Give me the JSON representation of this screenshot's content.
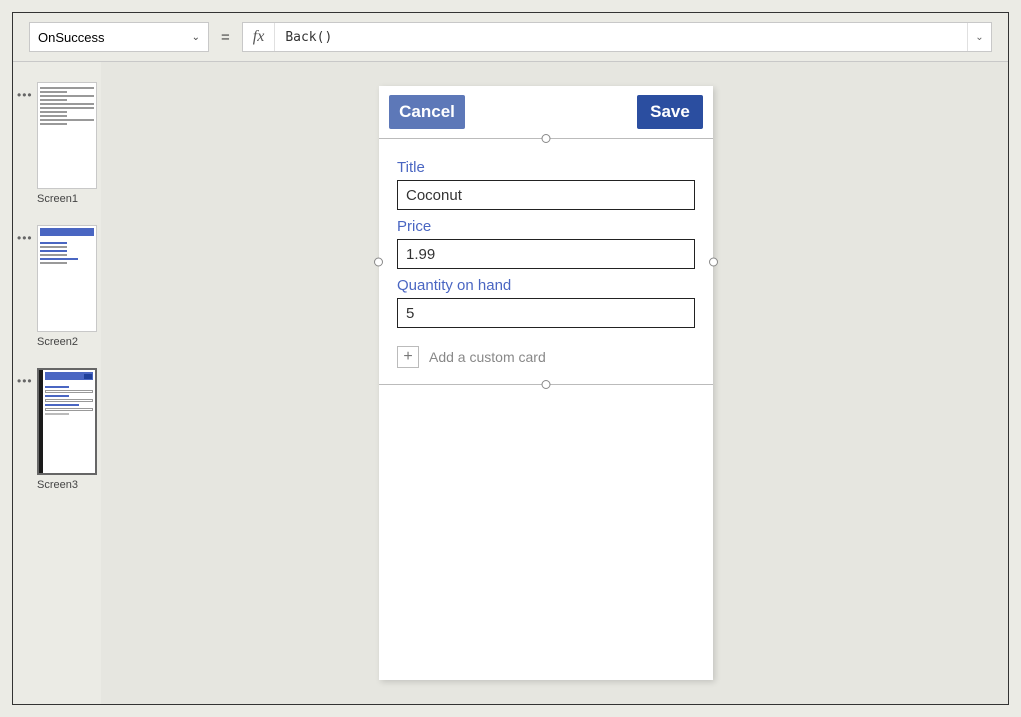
{
  "formulaBar": {
    "property": "OnSuccess",
    "equals": "=",
    "fxLabel": "fx",
    "formula": "Back()"
  },
  "screens": {
    "items": [
      {
        "label": "Screen1"
      },
      {
        "label": "Screen2"
      },
      {
        "label": "Screen3"
      }
    ]
  },
  "phone": {
    "cancelLabel": "Cancel",
    "saveLabel": "Save",
    "fields": [
      {
        "label": "Title",
        "value": "Coconut"
      },
      {
        "label": "Price",
        "value": "1.99"
      },
      {
        "label": "Quantity on hand",
        "value": "5"
      }
    ],
    "addCardLabel": "Add a custom card"
  }
}
